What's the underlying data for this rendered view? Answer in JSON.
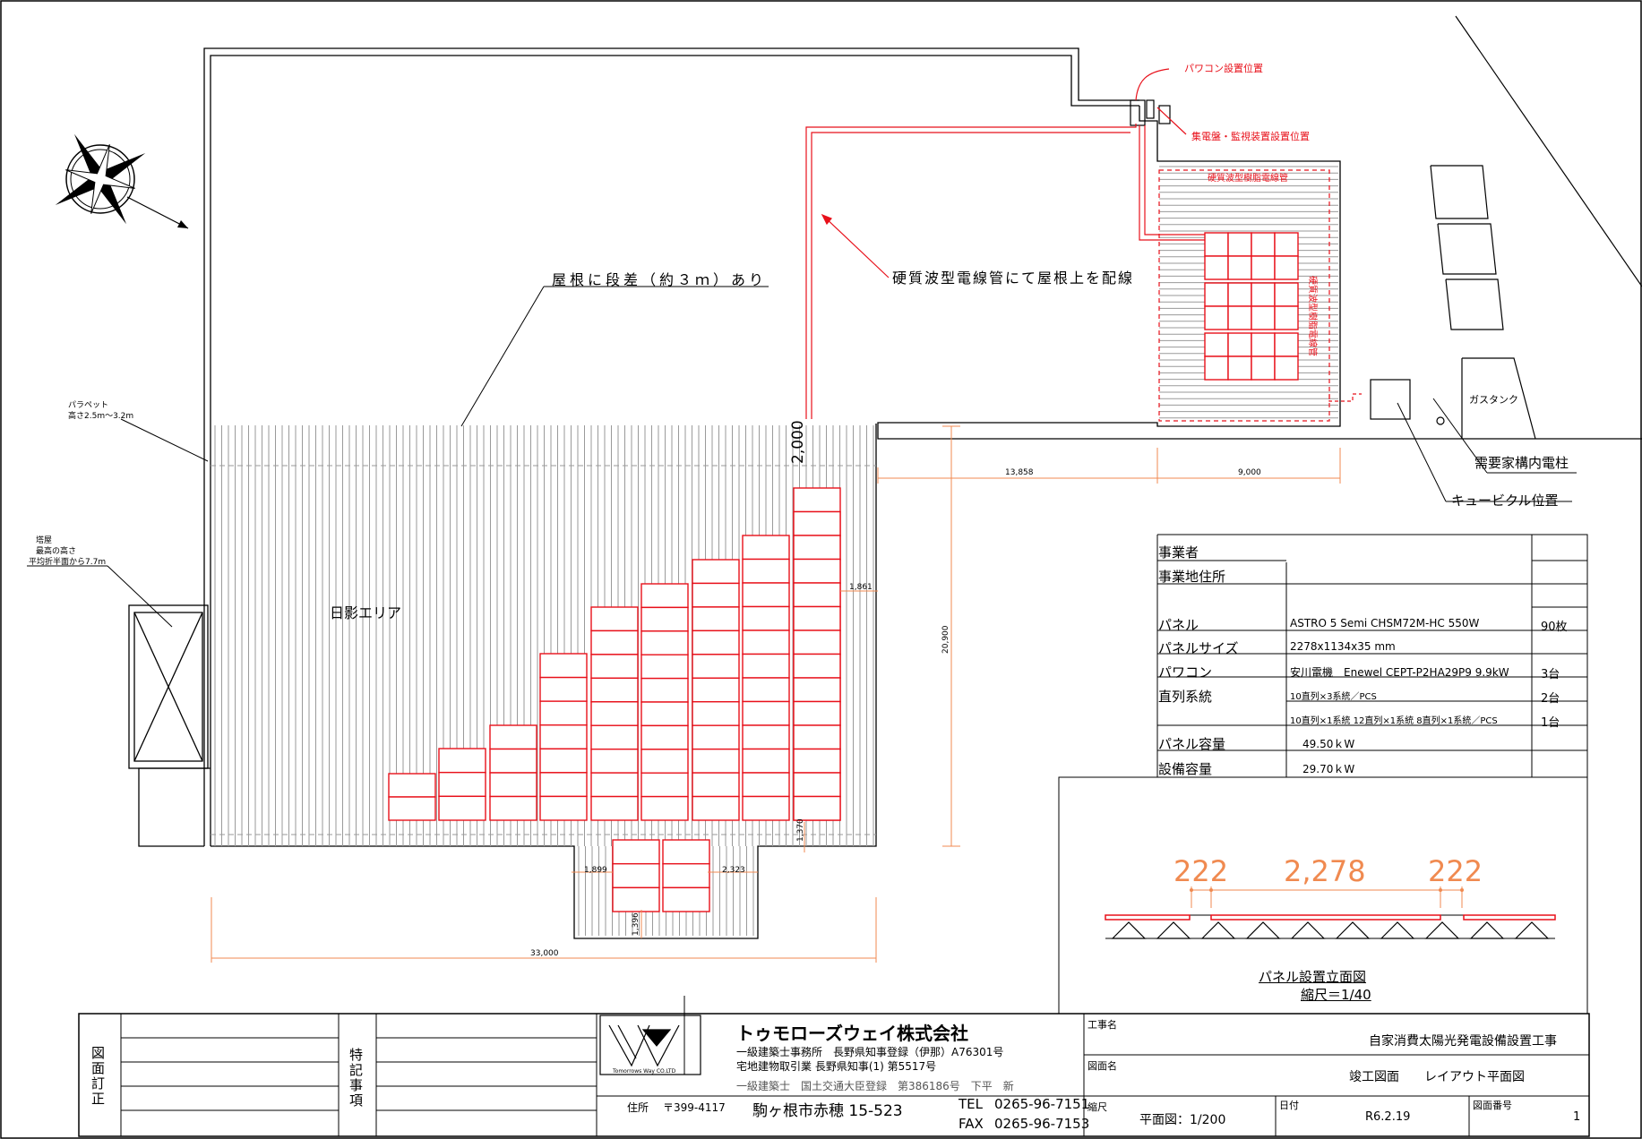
{
  "labels": {
    "step_note": "屋根に段差（約３ｍ）あり",
    "conduit_note": "硬質波型電線管にて屋根上を配線",
    "pcs_pos": "パワコン設置位置",
    "monitor_pos": "集電盤・監視装置設置位置",
    "conduit_small_1": "硬質波型樹脂電線管",
    "conduit_small_2": "硬質波型樹脂電線管",
    "parapet_1": "パラペット",
    "parapet_2": "高さ2.5m～3.2m",
    "tower_1": "塔屋",
    "tower_2": "最高の高さ",
    "tower_3": "平均折半面から7.7m",
    "shadow_area": "日影エリア",
    "gas_tank": "ガスタンク",
    "utility_pole": "需要家構内電柱",
    "cubicle": "キュービクル位置"
  },
  "dims": {
    "d2000": "2,000",
    "d13858": "13,858",
    "d9000": "9,000",
    "d1861": "1,861",
    "d20900": "20,900",
    "d1370": "1,370",
    "d1899": "1,899",
    "d2323": "2,323",
    "d1396": "1,396",
    "d33000": "33,000"
  },
  "spec_table": {
    "rows": [
      {
        "label": "事業者",
        "value": "",
        "qty": ""
      },
      {
        "label": "事業地住所",
        "value": "",
        "qty": ""
      },
      {
        "label": "",
        "value": "",
        "qty": ""
      },
      {
        "label": "パネル",
        "value": "ASTRO 5 Semi CHSM72M-HC 550W",
        "qty": "90枚"
      },
      {
        "label": "パネルサイズ",
        "value": "2278x1134x35 mm",
        "qty": ""
      },
      {
        "label": "パワコン",
        "value": "安川電機　Enewel CEPT-P2HA29P9 9.9kW",
        "qty": "3台"
      },
      {
        "label": "直列系統",
        "value": "10直列×3系統／PCS",
        "qty": "2台"
      },
      {
        "label": "",
        "value": "10直列×1系統 12直列×1系統 8直列×1系統／PCS",
        "qty": "1台"
      },
      {
        "label": "パネル容量",
        "value": "49.50ｋW",
        "qty": ""
      },
      {
        "label": "設備容量",
        "value": "29.70ｋW",
        "qty": ""
      }
    ]
  },
  "elevation": {
    "dim_left": "222",
    "dim_mid": "2,278",
    "dim_right": "222",
    "title": "パネル設置立面図",
    "scale": "縮尺＝1/40"
  },
  "title_block": {
    "rev_label": "図面訂正",
    "notes_label": "特記事項",
    "company": "トゥモローズウェイ株式会社",
    "logo_text": "Tomorrows Way  CO.LTD",
    "reg1": "一級建築士事務所　長野県知事登録（伊那）A76301号",
    "reg2": "宅地建物取引業 長野県知事(1) 第5517号",
    "reg3": "一級建築士　国土交通大臣登録　第386186号　下平　新",
    "addr_label": "住所",
    "postal": "〒399-4117",
    "address": "駒ヶ根市赤穂 15-523",
    "tel_label": "TEL",
    "tel": "0265-96-7151",
    "fax_label": "FAX",
    "fax": "0265-96-7153",
    "project_label": "工事名",
    "project": "自家消費太陽光発電設備設置工事",
    "drawing_label": "図面名",
    "drawing": "竣工図面　　レイアウト平面図",
    "scale_label": "縮尺",
    "scale": "平面図：1/200",
    "date_label": "日付",
    "date": "R6.2.19",
    "number_label": "図面番号",
    "number": "1"
  },
  "colors": {
    "panel": "#e8101a",
    "dimension": "#f08a50",
    "line": "#000000",
    "hatch": "#9a9a9a"
  }
}
